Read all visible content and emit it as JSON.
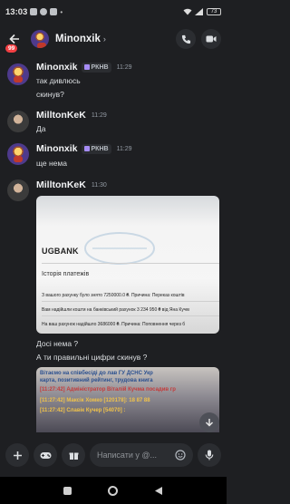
{
  "status_bar": {
    "time": "13:03",
    "battery": "73"
  },
  "header": {
    "notification_count": "99",
    "channel_name": "Minonxik"
  },
  "messages": [
    {
      "user": "Minonxik",
      "badge": "РКНВ",
      "time": "11:29",
      "lines": [
        "так дивлюсь",
        "скинув?"
      ]
    },
    {
      "user": "MilltonKeK",
      "time": "11:29",
      "lines": [
        "Да"
      ]
    },
    {
      "user": "Minonxik",
      "badge": "РКНВ",
      "time": "11:29",
      "lines": [
        "ще нема"
      ]
    },
    {
      "user": "MilltonKeK",
      "time": "11:30",
      "lines": [
        "Досі нема ?",
        "А ти правильні цифри скинув ?"
      ]
    }
  ],
  "attachment": {
    "bank": "UGBANK",
    "heading": "Історія платежів",
    "rows": [
      "З вашого рахунку було знято 7250000.0 ₴. Причина: Переказ коштів",
      "Вам надійшли кошти на банківський рахунок 3 234 950 ₴ від Яна Кучм",
      "На ваш рахунок надійшло 3686000 ₴. Причина: Поповнення через б"
    ]
  },
  "attachment2": {
    "line1": "Вітаємо на співбесіді до лав ГУ ДСНС Укр",
    "line2": "карта, позитивний рейтинг, трудова книга",
    "line3": "[11:27:42] Адміністратор Віталій Кучма посадив гр",
    "line4": "[11:27:42] Максік Хомко [120178]: 18 87 88",
    "line5": "[11:27:42] Славік Кучер [54070] :"
  },
  "composer": {
    "placeholder": "Написати у @..."
  },
  "colors": {
    "background": "#1e1f22",
    "badge_red": "#f23f43",
    "accent": "#a68cf5"
  }
}
